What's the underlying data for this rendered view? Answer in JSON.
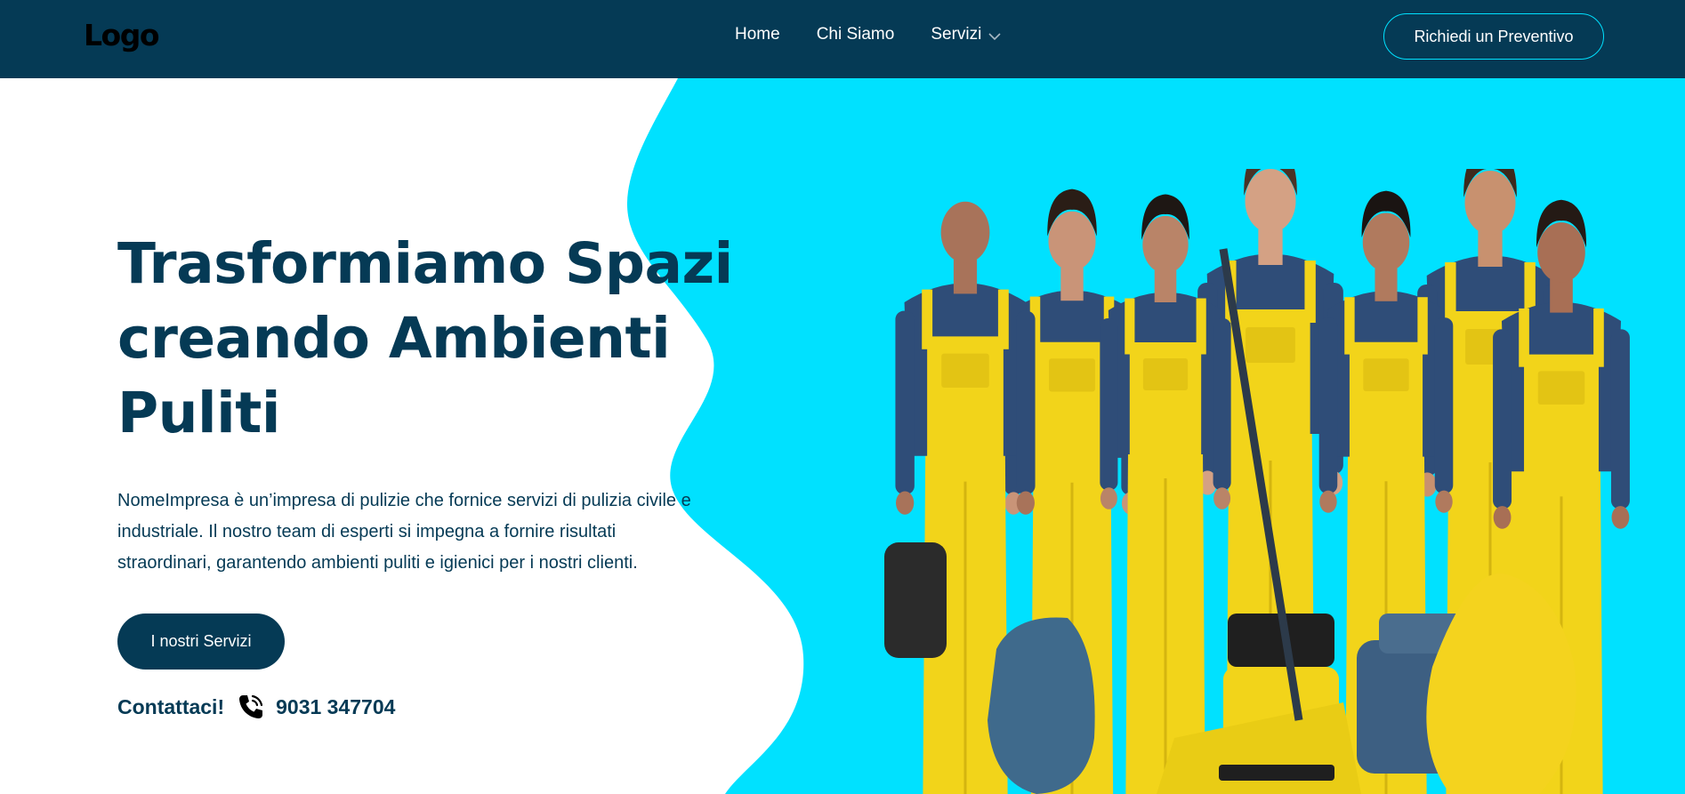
{
  "header": {
    "logo": "Logo",
    "nav": [
      {
        "label": "Home"
      },
      {
        "label": "Chi Siamo"
      },
      {
        "label": "Servizi",
        "icon": "chevron-down-icon"
      }
    ],
    "cta_label": "Richiedi un Preventivo"
  },
  "hero": {
    "title_lines": [
      "Trasformiamo Spazi",
      "creando Ambienti",
      "Puliti"
    ],
    "description_lines": [
      "NomeImpresa è un’impresa di pulizie che fornice servizi di pulizia civile e",
      "industriale. Il nostro team di esperti si impegna a fornire risultati",
      "straordinari, garantendo ambienti puliti e igienici per i nostri clienti."
    ],
    "button_label": "I nostri Servizi",
    "contact_label": "Contattaci!",
    "contact_icon": "phone-icon",
    "phone": "9031 347704",
    "image": "cleaning-team-photo"
  },
  "colors": {
    "navy": "#053a55",
    "cyan": "#00e1ff",
    "yellow": "#f2d41a",
    "shirt_blue": "#2f4d78",
    "white": "#ffffff"
  }
}
